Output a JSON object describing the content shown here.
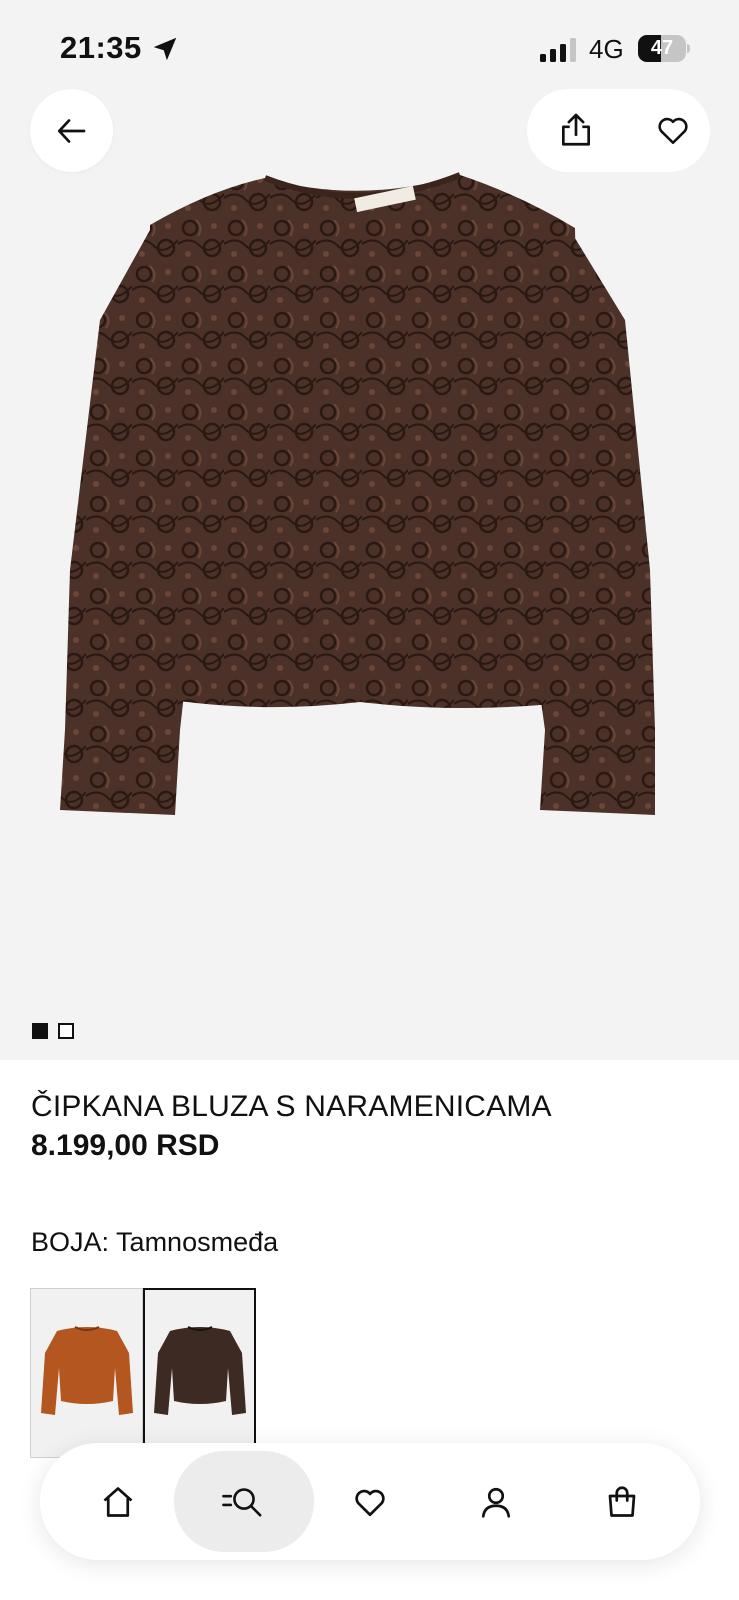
{
  "status_bar": {
    "time": "21:35",
    "network": "4G",
    "battery": "47",
    "battery_level": 0.47
  },
  "header": {
    "back_icon": "arrow-left-icon",
    "share_icon": "share-icon",
    "favorite_icon": "heart-icon"
  },
  "gallery": {
    "image_description": "brown-lace-blouse",
    "image_count": 2,
    "active_index": 0
  },
  "product": {
    "title": "ČIPKANA BLUZA S NARAMENICAMA",
    "price": "8.199,00 RSD",
    "color_label": "BOJA:",
    "color_value": "Tamnosmeđa"
  },
  "swatches": [
    {
      "color": "#b3561f",
      "selected": false
    },
    {
      "color": "#3d2a22",
      "selected": true
    }
  ],
  "nav": {
    "items": [
      {
        "icon": "home-icon",
        "active": false
      },
      {
        "icon": "search-icon",
        "active": true
      },
      {
        "icon": "heart-icon",
        "active": false
      },
      {
        "icon": "account-icon",
        "active": false
      },
      {
        "icon": "bag-icon",
        "active": false
      }
    ]
  },
  "colors": {
    "hero_background": "#f3f3f3",
    "garment_brown": "#4b3127",
    "garment_rust": "#b3561f",
    "text": "#111111",
    "active_nav_bg": "#ececec"
  }
}
